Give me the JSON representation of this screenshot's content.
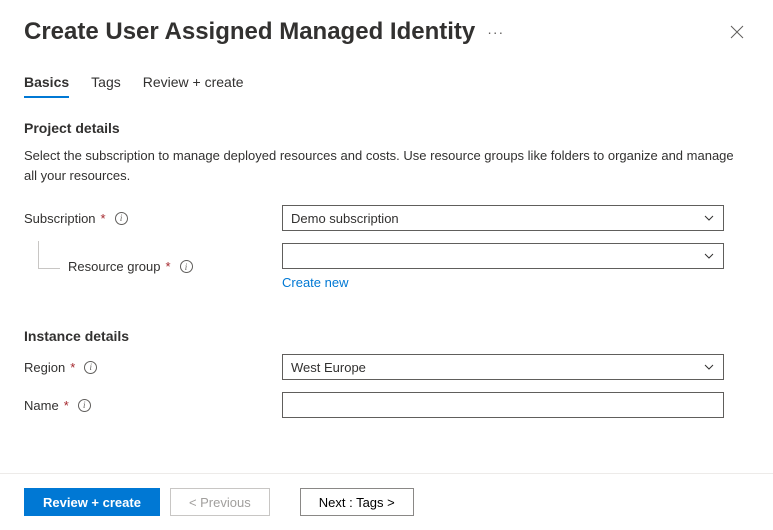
{
  "header": {
    "title": "Create User Assigned Managed Identity",
    "ellipsis": "···"
  },
  "tabs": {
    "basics": "Basics",
    "tags": "Tags",
    "review": "Review + create"
  },
  "project": {
    "title": "Project details",
    "desc": "Select the subscription to manage deployed resources and costs. Use resource groups like folders to organize and manage all your resources.",
    "subscription_label": "Subscription",
    "subscription_value": "Demo subscription",
    "resource_group_label": "Resource group",
    "resource_group_value": "",
    "create_new": "Create new"
  },
  "instance": {
    "title": "Instance details",
    "region_label": "Region",
    "region_value": "West Europe",
    "name_label": "Name",
    "name_value": ""
  },
  "footer": {
    "review": "Review + create",
    "previous": "< Previous",
    "next": "Next : Tags >"
  }
}
